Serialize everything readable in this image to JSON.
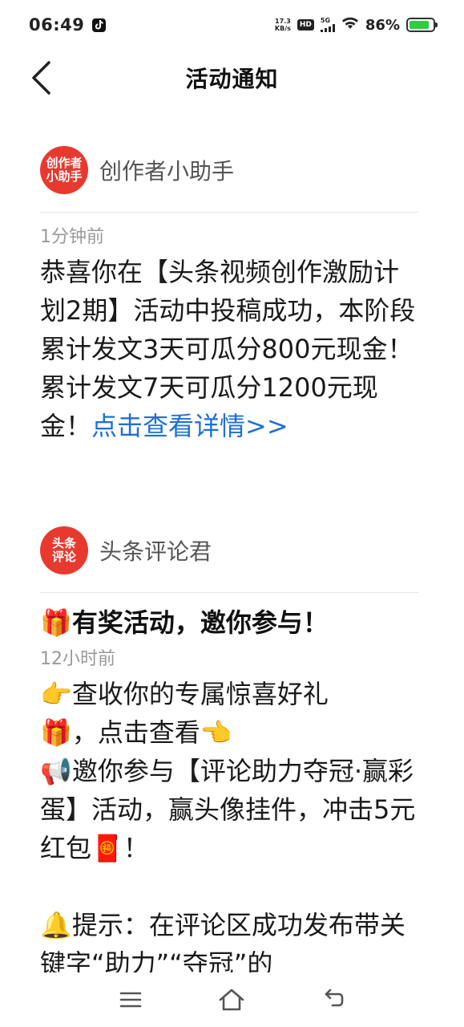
{
  "status_bar": {
    "time": "06:49",
    "net_speed_value": "17.3",
    "net_speed_unit": "KB/s",
    "hd_label": "HD",
    "network_label": "5G",
    "battery_percent": "86%",
    "battery_level": 0.86,
    "battery_color": "#2ecc40"
  },
  "header": {
    "title": "活动通知"
  },
  "notifications": [
    {
      "avatar_line1": "创作者",
      "avatar_line2": "小助手",
      "sender": "创作者小助手",
      "time": "1分钟前",
      "body": "恭喜你在【头条视频创作激励计划2期】活动中投稿成功，本阶段累计发文3天可瓜分800元现金！累计发文7天可瓜分1200元现金！",
      "link": "点击查看详情>>"
    },
    {
      "avatar_line1": "头条",
      "avatar_line2": "评论",
      "sender": "头条评论君",
      "title_emoji": "🎁",
      "title": "有奖活动，邀你参与！",
      "time": "12小时前",
      "line1_emoji": "👉",
      "line1": "查收你的专属惊喜好礼",
      "line2_emoji": "🎁",
      "line2": "，点击查看",
      "line2_end_emoji": "👈",
      "line3_emoji": "📢",
      "line3": "邀你参与【评论助力夺冠·赢彩蛋】活动，赢头像挂件，冲击5元红包",
      "line3_end_emoji": "🧧",
      "line3_end": "！",
      "tip_emoji": "🔔",
      "tip": "提示：在评论区成功发布带关键字“助力”“夺冠”的"
    }
  ],
  "colors": {
    "accent_link": "#1f6fd6",
    "avatar_red": "#e8392f"
  },
  "nav": {
    "menu_icon": "menu-icon",
    "home_icon": "home-icon",
    "back_icon": "back-icon"
  }
}
